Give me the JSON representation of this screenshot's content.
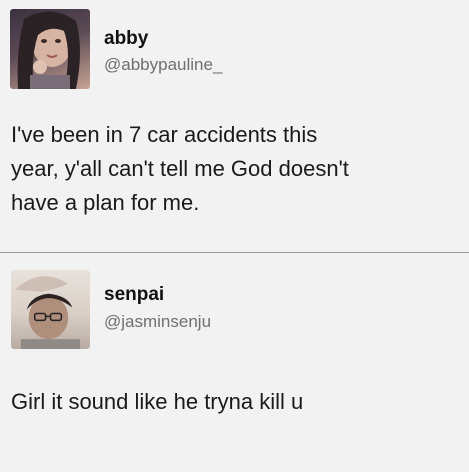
{
  "tweets": [
    {
      "display_name": "abby",
      "handle": "@abbypauline_",
      "text": "I've been in 7 car accidents this\nyear, y'all can't tell me God doesn't\nhave a plan for me."
    },
    {
      "display_name": "senpai",
      "handle": "@jasminsenju",
      "text": "Girl it sound like he tryna kill u"
    }
  ]
}
